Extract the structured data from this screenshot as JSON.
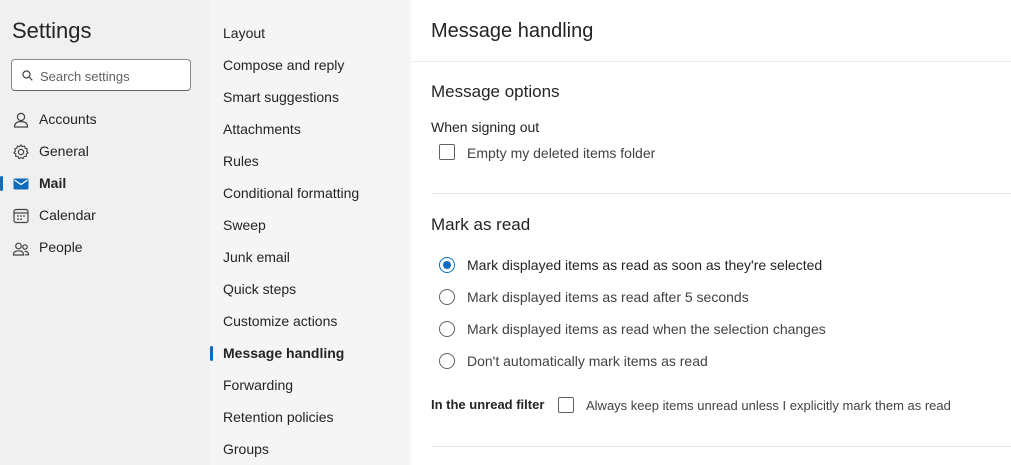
{
  "sidebar": {
    "title": "Settings",
    "search_placeholder": "Search settings",
    "items": [
      {
        "label": "Accounts",
        "icon": "person-icon"
      },
      {
        "label": "General",
        "icon": "gear-icon"
      },
      {
        "label": "Mail",
        "icon": "mail-icon",
        "active": true
      },
      {
        "label": "Calendar",
        "icon": "calendar-icon"
      },
      {
        "label": "People",
        "icon": "people-icon"
      }
    ]
  },
  "mail_nav": {
    "items": [
      "Layout",
      "Compose and reply",
      "Smart suggestions",
      "Attachments",
      "Rules",
      "Conditional formatting",
      "Sweep",
      "Junk email",
      "Quick steps",
      "Customize actions",
      "Message handling",
      "Forwarding",
      "Retention policies",
      "Groups"
    ],
    "active": "Message handling"
  },
  "main": {
    "title": "Message handling",
    "message_options": {
      "heading": "Message options",
      "when_signing_out": "When signing out",
      "empty_deleted": {
        "label": "Empty my deleted items folder",
        "checked": false
      }
    },
    "mark_as_read": {
      "heading": "Mark as read",
      "options": [
        {
          "label": "Mark displayed items as read as soon as they're selected",
          "selected": true
        },
        {
          "label": "Mark displayed items as read after 5 seconds",
          "selected": false
        },
        {
          "label": "Mark displayed items as read when the selection changes",
          "selected": false
        },
        {
          "label": "Don't automatically mark items as read",
          "selected": false
        }
      ],
      "unread_filter_label": "In the unread filter",
      "unread_filter_option": {
        "label": "Always keep items unread unless I explicitly mark them as read",
        "checked": false
      }
    }
  },
  "colors": {
    "accent": "#0f6cbd",
    "nav_bg": "#f0f0f0",
    "subnav_bg": "#f5f5f5"
  }
}
